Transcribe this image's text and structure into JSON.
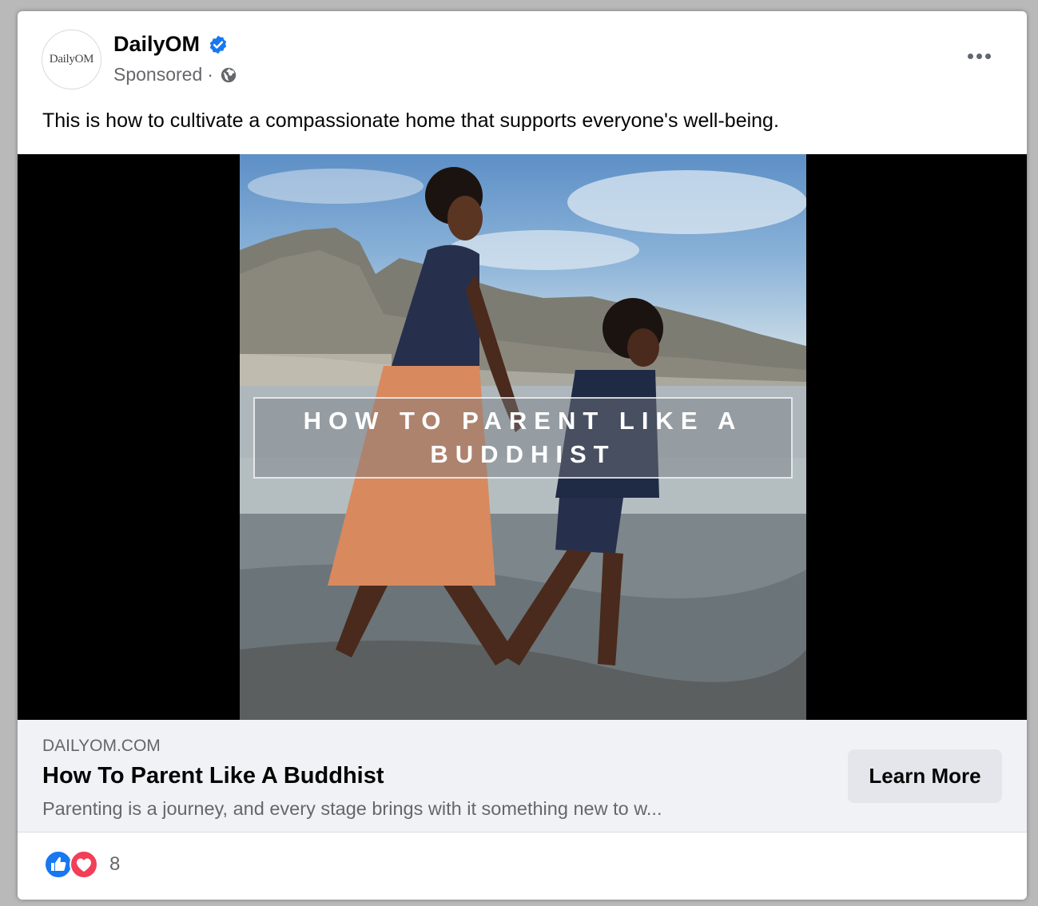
{
  "post": {
    "page_name": "DailyOM",
    "avatar_text": "DailyOM",
    "sponsored_label": "Sponsored",
    "meta_separator": "·",
    "caption": "This is how to cultivate a compassionate home that supports everyone's well-being."
  },
  "media": {
    "overlay_text": "HOW TO PARENT LIKE A BUDDHIST"
  },
  "link_preview": {
    "domain": "DAILYOM.COM",
    "title": "How To Parent Like A Buddhist",
    "description": "Parenting is a journey, and every stage brings with it something new to w...",
    "cta_label": "Learn More"
  },
  "reactions": {
    "count": "8",
    "icons": [
      "like-icon",
      "love-icon"
    ]
  },
  "colors": {
    "verified_blue": "#1877f2",
    "like_blue": "#1877f2",
    "love_red": "#f33e58",
    "link_background": "#f0f2f5",
    "button_background": "#e4e6eb",
    "secondary_text": "#65676b"
  }
}
